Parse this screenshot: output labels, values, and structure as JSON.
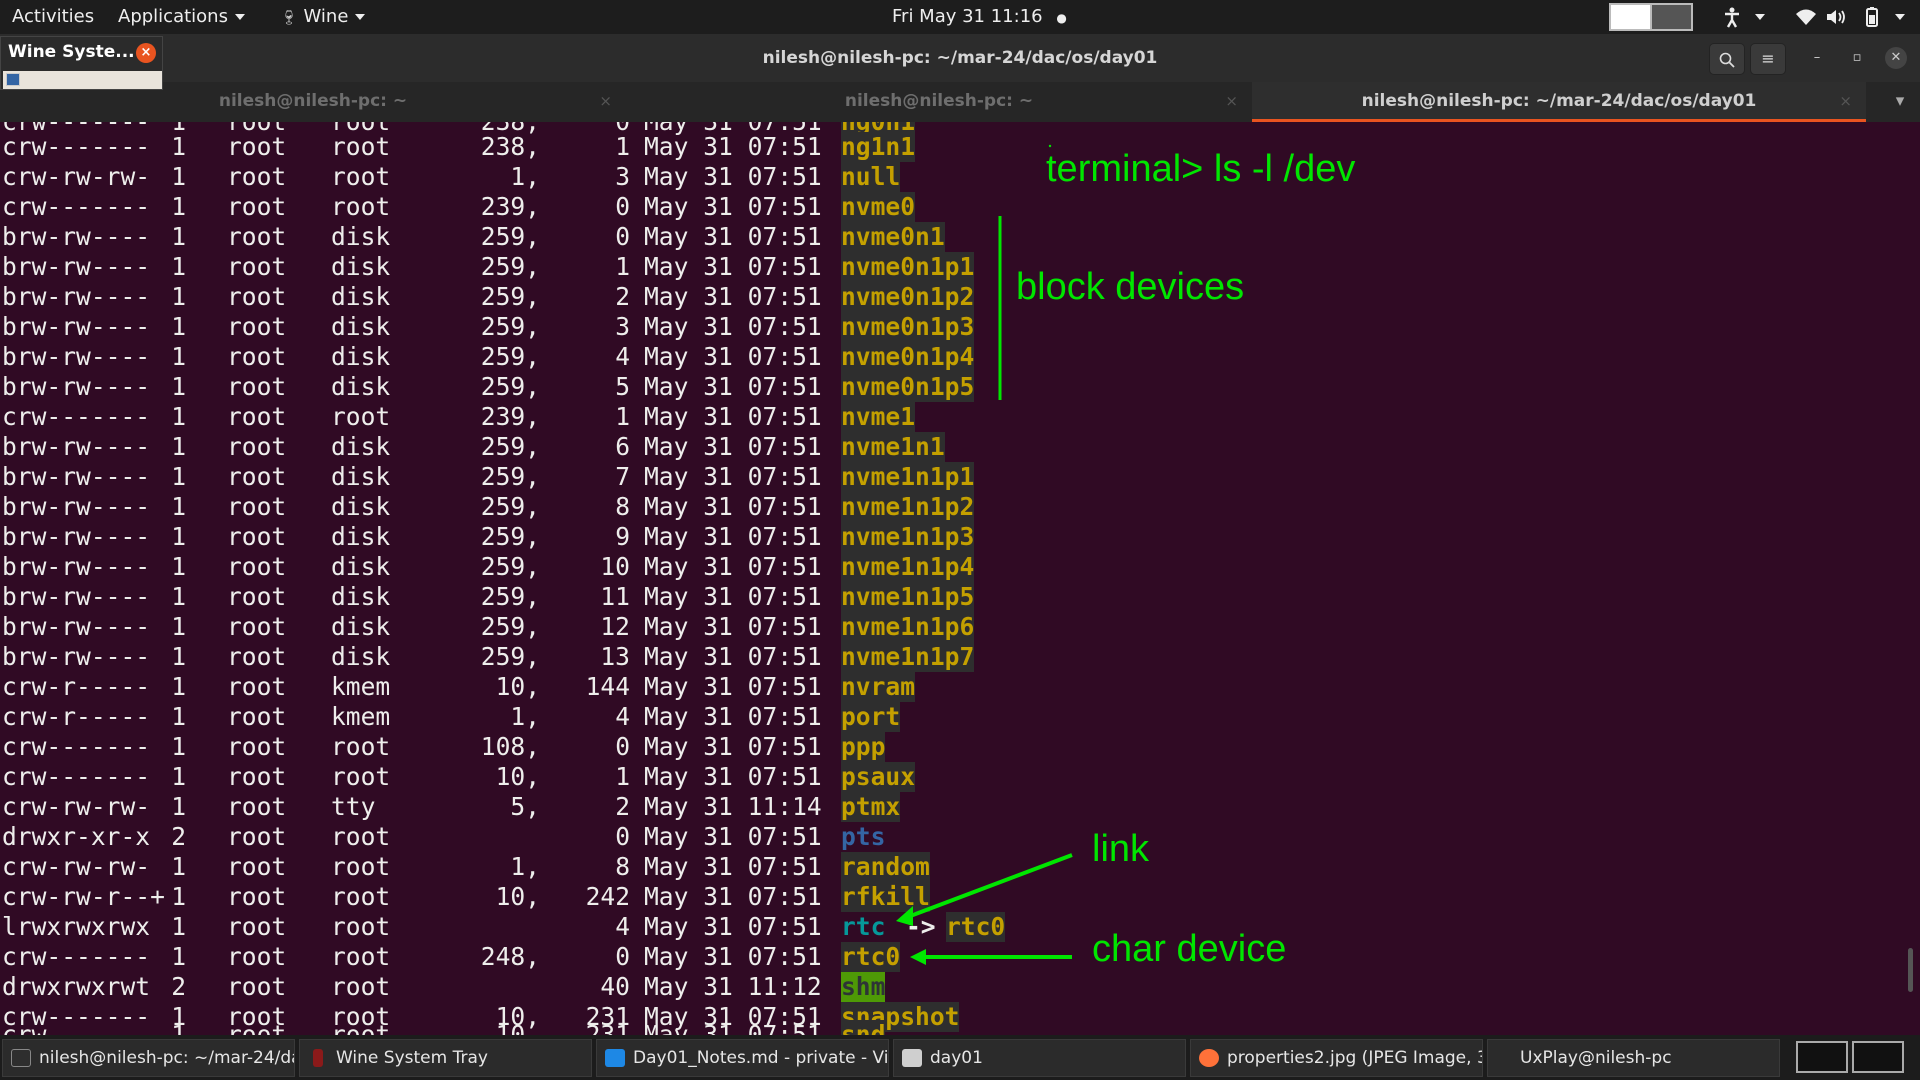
{
  "topbar": {
    "activities": "Activities",
    "applications": "Applications",
    "wine_menu": "Wine",
    "clock": "Fri May 31  11:16",
    "notification_dot": "●",
    "tray_icons": [
      "accessibility-icon",
      "wifi-icon",
      "volume-icon",
      "battery-icon"
    ]
  },
  "wine_popup": {
    "title": "Wine Syste...",
    "close": "×"
  },
  "window": {
    "title": "nilesh@nilesh-pc: ~/mar-24/dac/os/day01",
    "search_icon": "⌕",
    "menu_icon": "≡",
    "minimize": "–",
    "maximize": "▫",
    "close": "✕"
  },
  "tabs": [
    {
      "label": "nilesh@nilesh-pc: ~",
      "close": "×"
    },
    {
      "label": "nilesh@nilesh-pc: ~",
      "close": "×"
    },
    {
      "label": "nilesh@nilesh-pc: ~/mar-24/dac/os/day01",
      "close": "×"
    }
  ],
  "tab_overflow": "▾",
  "terminal": {
    "rows": [
      {
        "perm": "crw-------",
        "links": "1",
        "owner": "root",
        "group": "root",
        "major": "238,",
        "minor": "1",
        "date": "May 31 07:51",
        "name": "ng1n1",
        "kind": "dev"
      },
      {
        "perm": "crw-rw-rw-",
        "links": "1",
        "owner": "root",
        "group": "root",
        "major": "1,",
        "minor": "3",
        "date": "May 31 07:51",
        "name": "null",
        "kind": "dev"
      },
      {
        "perm": "crw-------",
        "links": "1",
        "owner": "root",
        "group": "root",
        "major": "239,",
        "minor": "0",
        "date": "May 31 07:51",
        "name": "nvme0",
        "kind": "dev"
      },
      {
        "perm": "brw-rw----",
        "links": "1",
        "owner": "root",
        "group": "disk",
        "major": "259,",
        "minor": "0",
        "date": "May 31 07:51",
        "name": "nvme0n1",
        "kind": "dev"
      },
      {
        "perm": "brw-rw----",
        "links": "1",
        "owner": "root",
        "group": "disk",
        "major": "259,",
        "minor": "1",
        "date": "May 31 07:51",
        "name": "nvme0n1p1",
        "kind": "dev"
      },
      {
        "perm": "brw-rw----",
        "links": "1",
        "owner": "root",
        "group": "disk",
        "major": "259,",
        "minor": "2",
        "date": "May 31 07:51",
        "name": "nvme0n1p2",
        "kind": "dev"
      },
      {
        "perm": "brw-rw----",
        "links": "1",
        "owner": "root",
        "group": "disk",
        "major": "259,",
        "minor": "3",
        "date": "May 31 07:51",
        "name": "nvme0n1p3",
        "kind": "dev"
      },
      {
        "perm": "brw-rw----",
        "links": "1",
        "owner": "root",
        "group": "disk",
        "major": "259,",
        "minor": "4",
        "date": "May 31 07:51",
        "name": "nvme0n1p4",
        "kind": "dev"
      },
      {
        "perm": "brw-rw----",
        "links": "1",
        "owner": "root",
        "group": "disk",
        "major": "259,",
        "minor": "5",
        "date": "May 31 07:51",
        "name": "nvme0n1p5",
        "kind": "dev"
      },
      {
        "perm": "crw-------",
        "links": "1",
        "owner": "root",
        "group": "root",
        "major": "239,",
        "minor": "1",
        "date": "May 31 07:51",
        "name": "nvme1",
        "kind": "dev"
      },
      {
        "perm": "brw-rw----",
        "links": "1",
        "owner": "root",
        "group": "disk",
        "major": "259,",
        "minor": "6",
        "date": "May 31 07:51",
        "name": "nvme1n1",
        "kind": "dev"
      },
      {
        "perm": "brw-rw----",
        "links": "1",
        "owner": "root",
        "group": "disk",
        "major": "259,",
        "minor": "7",
        "date": "May 31 07:51",
        "name": "nvme1n1p1",
        "kind": "dev"
      },
      {
        "perm": "brw-rw----",
        "links": "1",
        "owner": "root",
        "group": "disk",
        "major": "259,",
        "minor": "8",
        "date": "May 31 07:51",
        "name": "nvme1n1p2",
        "kind": "dev"
      },
      {
        "perm": "brw-rw----",
        "links": "1",
        "owner": "root",
        "group": "disk",
        "major": "259,",
        "minor": "9",
        "date": "May 31 07:51",
        "name": "nvme1n1p3",
        "kind": "dev"
      },
      {
        "perm": "brw-rw----",
        "links": "1",
        "owner": "root",
        "group": "disk",
        "major": "259,",
        "minor": "10",
        "date": "May 31 07:51",
        "name": "nvme1n1p4",
        "kind": "dev"
      },
      {
        "perm": "brw-rw----",
        "links": "1",
        "owner": "root",
        "group": "disk",
        "major": "259,",
        "minor": "11",
        "date": "May 31 07:51",
        "name": "nvme1n1p5",
        "kind": "dev"
      },
      {
        "perm": "brw-rw----",
        "links": "1",
        "owner": "root",
        "group": "disk",
        "major": "259,",
        "minor": "12",
        "date": "May 31 07:51",
        "name": "nvme1n1p6",
        "kind": "dev"
      },
      {
        "perm": "brw-rw----",
        "links": "1",
        "owner": "root",
        "group": "disk",
        "major": "259,",
        "minor": "13",
        "date": "May 31 07:51",
        "name": "nvme1n1p7",
        "kind": "dev"
      },
      {
        "perm": "crw-r-----",
        "links": "1",
        "owner": "root",
        "group": "kmem",
        "major": "10,",
        "minor": "144",
        "date": "May 31 07:51",
        "name": "nvram",
        "kind": "dev"
      },
      {
        "perm": "crw-r-----",
        "links": "1",
        "owner": "root",
        "group": "kmem",
        "major": "1,",
        "minor": "4",
        "date": "May 31 07:51",
        "name": "port",
        "kind": "dev"
      },
      {
        "perm": "crw-------",
        "links": "1",
        "owner": "root",
        "group": "root",
        "major": "108,",
        "minor": "0",
        "date": "May 31 07:51",
        "name": "ppp",
        "kind": "dev"
      },
      {
        "perm": "crw-------",
        "links": "1",
        "owner": "root",
        "group": "root",
        "major": "10,",
        "minor": "1",
        "date": "May 31 07:51",
        "name": "psaux",
        "kind": "dev"
      },
      {
        "perm": "crw-rw-rw-",
        "links": "1",
        "owner": "root",
        "group": "tty",
        "major": "5,",
        "minor": "2",
        "date": "May 31 11:14",
        "name": "ptmx",
        "kind": "dev"
      },
      {
        "perm": "drwxr-xr-x",
        "links": "2",
        "owner": "root",
        "group": "root",
        "major": "",
        "minor": "0",
        "date": "May 31 07:51",
        "name": "pts",
        "kind": "dir"
      },
      {
        "perm": "crw-rw-rw-",
        "links": "1",
        "owner": "root",
        "group": "root",
        "major": "1,",
        "minor": "8",
        "date": "May 31 07:51",
        "name": "random",
        "kind": "dev"
      },
      {
        "perm": "crw-rw-r--+",
        "links": "1",
        "owner": "root",
        "group": "root",
        "major": "10,",
        "minor": "242",
        "date": "May 31 07:51",
        "name": "rfkill",
        "kind": "dev"
      },
      {
        "perm": "lrwxrwxrwx",
        "links": "1",
        "owner": "root",
        "group": "root",
        "major": "",
        "minor": "4",
        "date": "May 31 07:51",
        "name": "rtc",
        "kind": "link",
        "arrow": "->",
        "target": "rtc0"
      },
      {
        "perm": "crw-------",
        "links": "1",
        "owner": "root",
        "group": "root",
        "major": "248,",
        "minor": "0",
        "date": "May 31 07:51",
        "name": "rtc0",
        "kind": "dev"
      },
      {
        "perm": "drwxrwxrwt",
        "links": "2",
        "owner": "root",
        "group": "root",
        "major": "",
        "minor": "40",
        "date": "May 31 11:12",
        "name": "shm",
        "kind": "sticky"
      },
      {
        "perm": "crw-------",
        "links": "1",
        "owner": "root",
        "group": "root",
        "major": "10,",
        "minor": "231",
        "date": "May 31 07:51",
        "name": "snapshot",
        "kind": "dev"
      }
    ]
  },
  "annotations": {
    "command": "terminal> ls  -l   /dev",
    "block_devices": "block devices",
    "link": "link",
    "char_device": "char device",
    "color": "#00e600"
  },
  "taskbar": [
    {
      "label": "nilesh@nilesh-pc: ~/mar-24/da...",
      "icon": "terminal-icon"
    },
    {
      "label": "Wine System Tray",
      "icon": "wine-icon"
    },
    {
      "label": "Day01_Notes.md - private - Vis...",
      "icon": "vscode-icon"
    },
    {
      "label": "day01",
      "icon": "folder-icon"
    },
    {
      "label": "properties2.jpg (JPEG Image, 3...",
      "icon": "firefox-icon"
    },
    {
      "label": "UxPlay@nilesh-pc",
      "icon": ""
    }
  ],
  "colors": {
    "terminal_bg": "#300a24",
    "device_name": "#c4a000",
    "accent": "#e95420"
  }
}
